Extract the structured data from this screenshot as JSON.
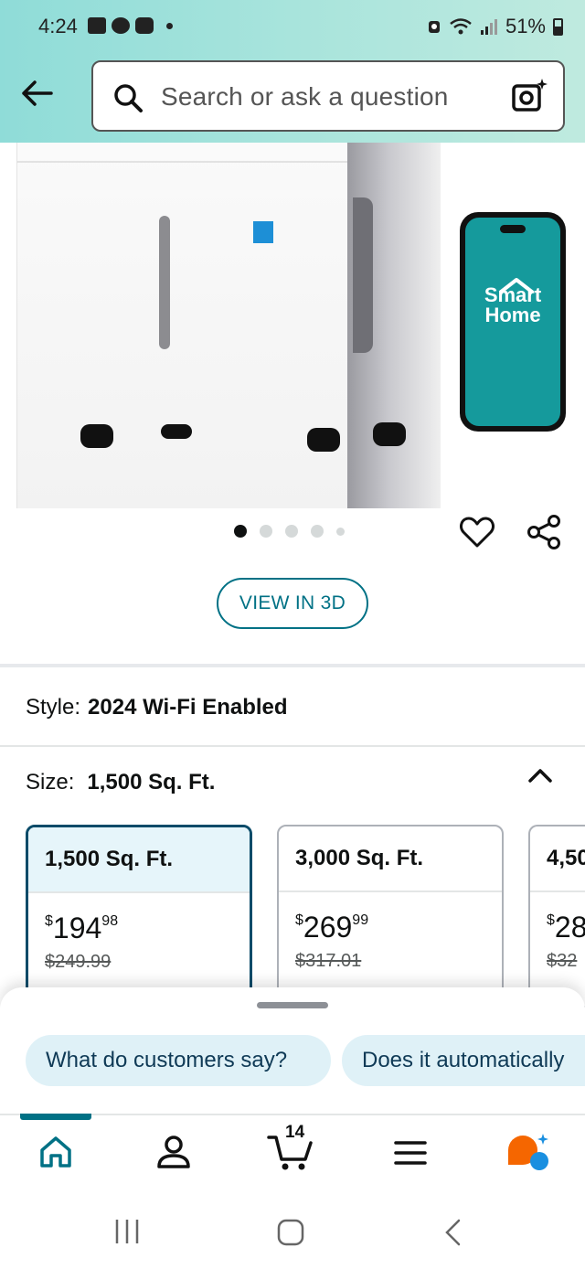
{
  "status_bar": {
    "time": "4:24",
    "battery": "51%"
  },
  "search": {
    "placeholder": "Search or ask a question"
  },
  "product_image": {
    "phone_text_line1": "Smart",
    "phone_text_line2": "Home"
  },
  "carousel": {
    "total": 5,
    "active": 1
  },
  "view3d": {
    "label": "VIEW IN 3D"
  },
  "style": {
    "label": "Style:",
    "value": "2024 Wi-Fi Enabled"
  },
  "size": {
    "label": "Size:",
    "value": "1,500 Sq. Ft.",
    "options": [
      {
        "name": "1,500 Sq. Ft.",
        "price_dollars": "194",
        "price_cents": "98",
        "list_price": "$249.99",
        "selected": true
      },
      {
        "name": "3,000 Sq. Ft.",
        "price_dollars": "269",
        "price_cents": "99",
        "list_price": "$317.01",
        "selected": false
      },
      {
        "name": "4,50",
        "price_dollars": "28",
        "price_cents": "",
        "list_price": "$32",
        "selected": false
      }
    ]
  },
  "suggestions": [
    "What do customers say?",
    "Does it automatically"
  ],
  "nav": {
    "cart_count": "14"
  },
  "colors": {
    "accent": "#007185",
    "selected_border": "#0a4b69",
    "chip_bg": "#dff1f7"
  }
}
